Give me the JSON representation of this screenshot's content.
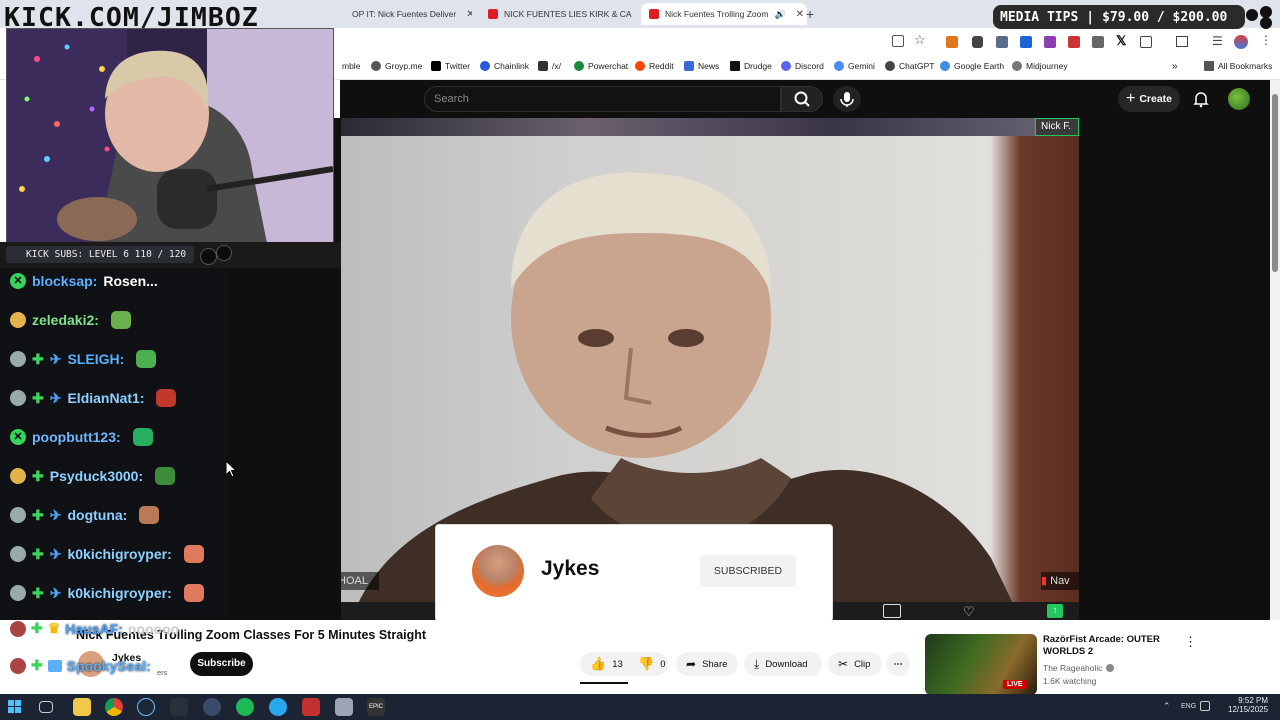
{
  "overlay": {
    "logo_text": "KICK.COM/JIMBOZ",
    "media_tips_label": "MEDIA TIPS",
    "media_tips_amount": "$79.00 / $200.00",
    "kick_subs": "KICK SUBS: LEVEL 6 110 / 120"
  },
  "browser": {
    "tabs": [
      {
        "title": "OP IT: Nick Fuentes Deliver"
      },
      {
        "title": "NICK FUENTES LIES KIRK & CA"
      },
      {
        "title": "Nick Fuentes Trolling Zoom"
      }
    ],
    "bookmarks": [
      "mble",
      "Groyp.me",
      "Twitter",
      "Chainlink",
      "/x/",
      "Powerchat",
      "Reddit",
      "News",
      "Drudge",
      "Discord",
      "Gemini",
      "ChatGPT",
      "Google Earth",
      "Midjourney"
    ],
    "all_bookmarks": "All Bookmarks"
  },
  "youtube": {
    "search_placeholder": "Search",
    "create_label": "Create",
    "video_labels": {
      "top_right": "Nick F.",
      "bottom_left": "FRANCISCO PASCHOAL",
      "bottom_right": "Nav"
    },
    "subscribe_popup": {
      "channel": "Jykes",
      "button": "SUBSCRIBED"
    },
    "video_title": "Nick Fuentes Trolling Zoom Classes For 5 Minutes Straight",
    "channel_name": "Jykes",
    "channel_subs_fragment": "ers",
    "subscribe_label": "Subscribe",
    "likes": "13",
    "dislikes": "0",
    "share_label": "Share",
    "download_label": "Download",
    "clip_label": "Clip",
    "recommended": {
      "title": "RazörFist Arcade: OUTER WORLDS 2",
      "channel": "The Rageaholic",
      "watching": "1.6K watching",
      "live_badge": "LIVE"
    }
  },
  "chat": [
    {
      "user": "blocksap:",
      "msg": "Rosen...",
      "color": "#5ab0ff"
    },
    {
      "user": "zeledaki2:",
      "msg": "",
      "color": "#7fe38a"
    },
    {
      "user": "SLEIGH:",
      "msg": "",
      "color": "#5ab0ff"
    },
    {
      "user": "EldianNat1:",
      "msg": "",
      "color": "#8ed0ff"
    },
    {
      "user": "poopbutt123:",
      "msg": "",
      "color": "#6fb6ff"
    },
    {
      "user": "Psyduck3000:",
      "msg": "",
      "color": "#8ed0ff"
    },
    {
      "user": "dogtuna:",
      "msg": "",
      "color": "#8ed0ff"
    },
    {
      "user": "k0kichigroyper:",
      "msg": "",
      "color": "#8ed0ff"
    },
    {
      "user": "k0kichigroyper:",
      "msg": "",
      "color": "#8ed0ff"
    }
  ],
  "chat_overlap": {
    "user1": "HausAF:",
    "msg1": "nooooo",
    "user2": "SpookySeal:"
  },
  "system": {
    "time": "9:52 PM",
    "date": "12/15/2025",
    "lang": "ENG"
  },
  "colors": {
    "youtube_dark": "#0f0f0f",
    "kick_green": "#53fc18",
    "accent_red": "#ff0033"
  }
}
